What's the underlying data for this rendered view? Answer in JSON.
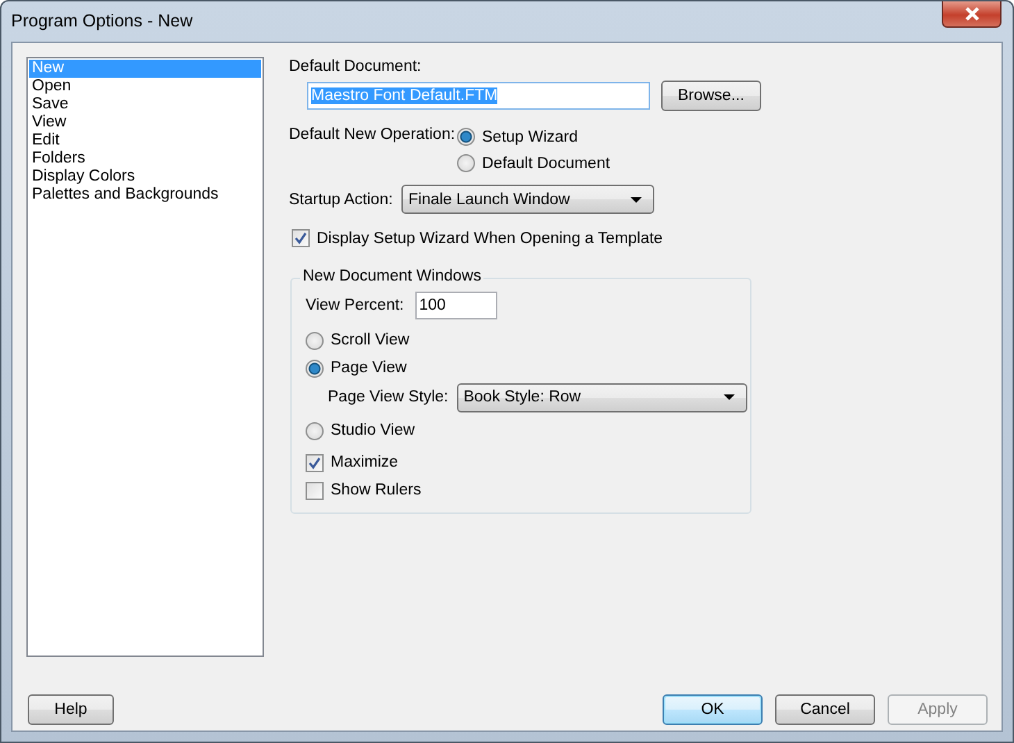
{
  "window": {
    "title": "Program Options - New"
  },
  "sidebar": {
    "items": [
      {
        "label": "New",
        "selected": true
      },
      {
        "label": "Open",
        "selected": false
      },
      {
        "label": "Save",
        "selected": false
      },
      {
        "label": "View",
        "selected": false
      },
      {
        "label": "Edit",
        "selected": false
      },
      {
        "label": "Folders",
        "selected": false
      },
      {
        "label": "Display Colors",
        "selected": false
      },
      {
        "label": "Palettes and Backgrounds",
        "selected": false
      }
    ]
  },
  "default_document": {
    "label": "Default Document:",
    "value": "Maestro Font Default.FTM",
    "text_selected": true,
    "button": "Browse..."
  },
  "default_new_operation": {
    "label": "Default New Operation:",
    "options": [
      {
        "label": "Setup Wizard",
        "selected": true
      },
      {
        "label": "Default Document",
        "selected": false
      }
    ]
  },
  "startup_action": {
    "label": "Startup Action:",
    "value": "Finale Launch Window"
  },
  "display_setup_wizard": {
    "label": "Display Setup Wizard When Opening a Template",
    "checked": true
  },
  "new_document_windows": {
    "title": "New Document Windows",
    "view_percent": {
      "label": "View Percent:",
      "value": "100"
    },
    "views": [
      {
        "label": "Scroll View",
        "selected": false
      },
      {
        "label": "Page View",
        "selected": true,
        "sub_option": {
          "label": "Page View Style:",
          "value": "Book Style: Row"
        }
      },
      {
        "label": "Studio View",
        "selected": false
      }
    ],
    "checkboxes": [
      {
        "label": "Maximize",
        "checked": true
      },
      {
        "label": "Show Rulers",
        "checked": false
      }
    ]
  },
  "buttons": [
    {
      "label": "Help",
      "kind": "left",
      "default": false,
      "disabled": false
    },
    {
      "label": "OK",
      "kind": "right",
      "default": true,
      "disabled": false
    },
    {
      "label": "Cancel",
      "kind": "right",
      "default": false,
      "disabled": false
    },
    {
      "label": "Apply",
      "kind": "right",
      "default": false,
      "disabled": true
    }
  ]
}
